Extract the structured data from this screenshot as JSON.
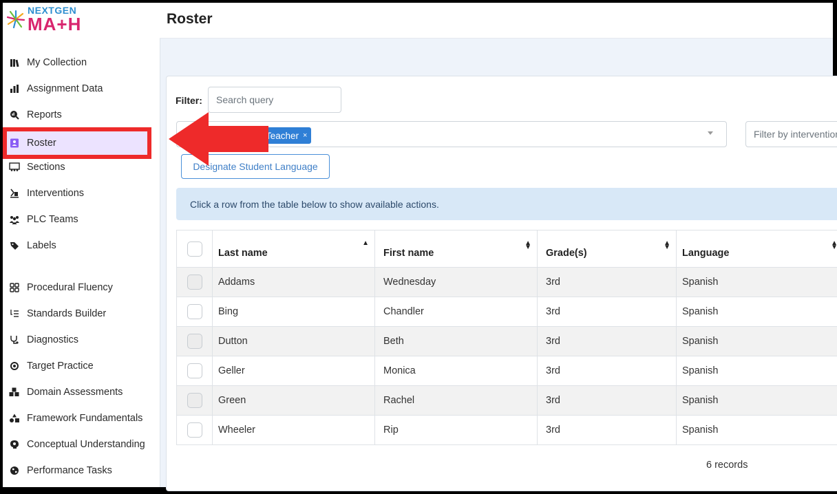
{
  "app": {
    "logo_top": "NEXTGEN",
    "logo_bottom": "MA+H"
  },
  "page": {
    "title": "Roster"
  },
  "sidebar": {
    "items": [
      {
        "label": "My Collection",
        "icon": "books-icon"
      },
      {
        "label": "Assignment Data",
        "icon": "bar-chart-icon"
      },
      {
        "label": "Reports",
        "icon": "magnify-chart-icon"
      },
      {
        "label": "Roster",
        "icon": "contact-card-icon",
        "active": true
      },
      {
        "label": "Sections",
        "icon": "classroom-icon"
      },
      {
        "label": "Interventions",
        "icon": "pedestal-icon"
      },
      {
        "label": "PLC Teams",
        "icon": "users-icon"
      },
      {
        "label": "Labels",
        "icon": "tag-icon"
      },
      {
        "label": "Procedural Fluency",
        "icon": "grid-icon"
      },
      {
        "label": "Standards Builder",
        "icon": "list-icon"
      },
      {
        "label": "Diagnostics",
        "icon": "stethoscope-icon"
      },
      {
        "label": "Target Practice",
        "icon": "target-icon"
      },
      {
        "label": "Domain Assessments",
        "icon": "cubes-icon"
      },
      {
        "label": "Framework Fundamentals",
        "icon": "shapes-icon"
      },
      {
        "label": "Conceptual Understanding",
        "icon": "brain-icon"
      },
      {
        "label": "Performance Tasks",
        "icon": "globe-icon"
      }
    ]
  },
  "filter": {
    "label": "Filter:",
    "search_placeholder": "Search query",
    "selected_tag": "Teacher",
    "tag_remove": "×",
    "intervention_placeholder": "Filter by intervention"
  },
  "actions": {
    "designate_language": "Designate Student Language"
  },
  "info": {
    "message": "Click a row from the table below to show available actions."
  },
  "table": {
    "headers": [
      "Last name",
      "First name",
      "Grade(s)",
      "Language"
    ],
    "rows": [
      [
        "Addams",
        "Wednesday",
        "3rd",
        "Spanish"
      ],
      [
        "Bing",
        "Chandler",
        "3rd",
        "Spanish"
      ],
      [
        "Dutton",
        "Beth",
        "3rd",
        "Spanish"
      ],
      [
        "Geller",
        "Monica",
        "3rd",
        "Spanish"
      ],
      [
        "Green",
        "Rachel",
        "3rd",
        "Spanish"
      ],
      [
        "Wheeler",
        "Rip",
        "3rd",
        "Spanish"
      ]
    ],
    "record_count": "6 records"
  },
  "colors": {
    "accent": "#2f7fd6",
    "annotation_red": "#ee2a2a",
    "active_bg": "#ece3ff"
  }
}
